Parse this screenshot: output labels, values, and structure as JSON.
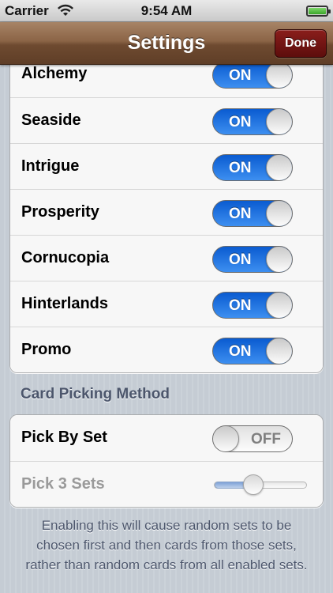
{
  "status_bar": {
    "carrier": "Carrier",
    "time": "9:54 AM",
    "battery_level": 1.0
  },
  "nav": {
    "title": "Settings",
    "done_label": "Done"
  },
  "expansions": {
    "items": [
      {
        "label": "Alchemy",
        "state": "ON"
      },
      {
        "label": "Seaside",
        "state": "ON"
      },
      {
        "label": "Intrigue",
        "state": "ON"
      },
      {
        "label": "Prosperity",
        "state": "ON"
      },
      {
        "label": "Cornucopia",
        "state": "ON"
      },
      {
        "label": "Hinterlands",
        "state": "ON"
      },
      {
        "label": "Promo",
        "state": "ON"
      }
    ]
  },
  "card_picking": {
    "header": "Card Picking Method",
    "pick_by_set_label": "Pick By Set",
    "pick_by_set_state": "OFF",
    "pick_sets_label": "Pick 3 Sets",
    "pick_sets_value": 3,
    "slider_fraction": 0.4
  },
  "footer": {
    "text": "Enabling this will cause random sets to be chosen first and then cards from those sets, rather than random cards from all enabled sets."
  },
  "colors": {
    "nav_brown": "#7a5537",
    "done_red": "#7a1715",
    "switch_on_blue": "#1f6fe0",
    "section_text": "#4c566c"
  },
  "icons": [
    "wifi-icon",
    "battery-icon"
  ]
}
